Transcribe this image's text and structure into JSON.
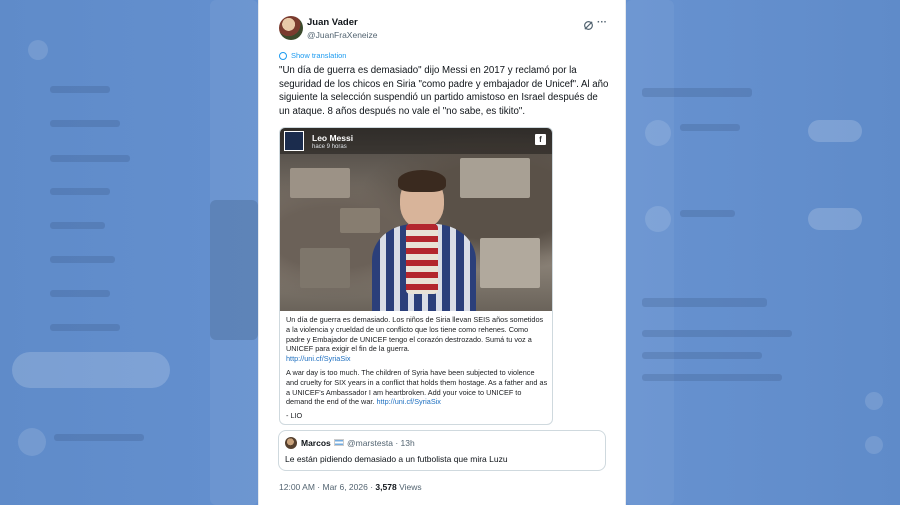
{
  "tweet": {
    "author_name": "Juan Vader",
    "author_handle": "@JuanFraXeneize",
    "show_translation": "Show translation",
    "text": "\"Un día de guerra es demasiado\" dijo Messi en 2017 y reclamó por la seguridad de los chicos en Siria \"como padre y embajador de Unicef\". Al año siguiente la selección suspendió un partido amistoso en Israel después de un ataque. 8 años después no vale el \"no sabe, es tikito\".",
    "time": "12:00 AM",
    "date": "Mar 6, 2026",
    "views_count": "3,578",
    "views_label": "Views",
    "more_icon": "···"
  },
  "embed": {
    "page_name": "Leo Messi",
    "page_sub": "hace 9 horas",
    "fb_icon": "f",
    "spanish_text": "Un día de guerra es demasiado. Los niños de Siria llevan SEIS años sometidos a la violencia y crueldad de un conflicto que los tiene como rehenes. Como padre y Embajador de UNICEF tengo el corazón destrozado. Sumá tu voz a UNICEF para exigir el fin de la guerra.",
    "spanish_link": "http://uni.cf/SyriaSix",
    "english_text": "A war day is too much. The children of Syria have been subjected to violence and cruelty for SIX years in a conflict that holds them hostage. As a father and as a UNICEF's Ambassador I am heartbroken. Add your voice to UNICEF to demand the end of the war.",
    "english_link": "http://uni.cf/SyriaSix",
    "signature": "- LIO"
  },
  "quote": {
    "name": "Marcos",
    "handle": "@marstesta",
    "time": "· 13h",
    "text": "Le están pidiendo demasiado a un futbolista que mira Luzu"
  }
}
